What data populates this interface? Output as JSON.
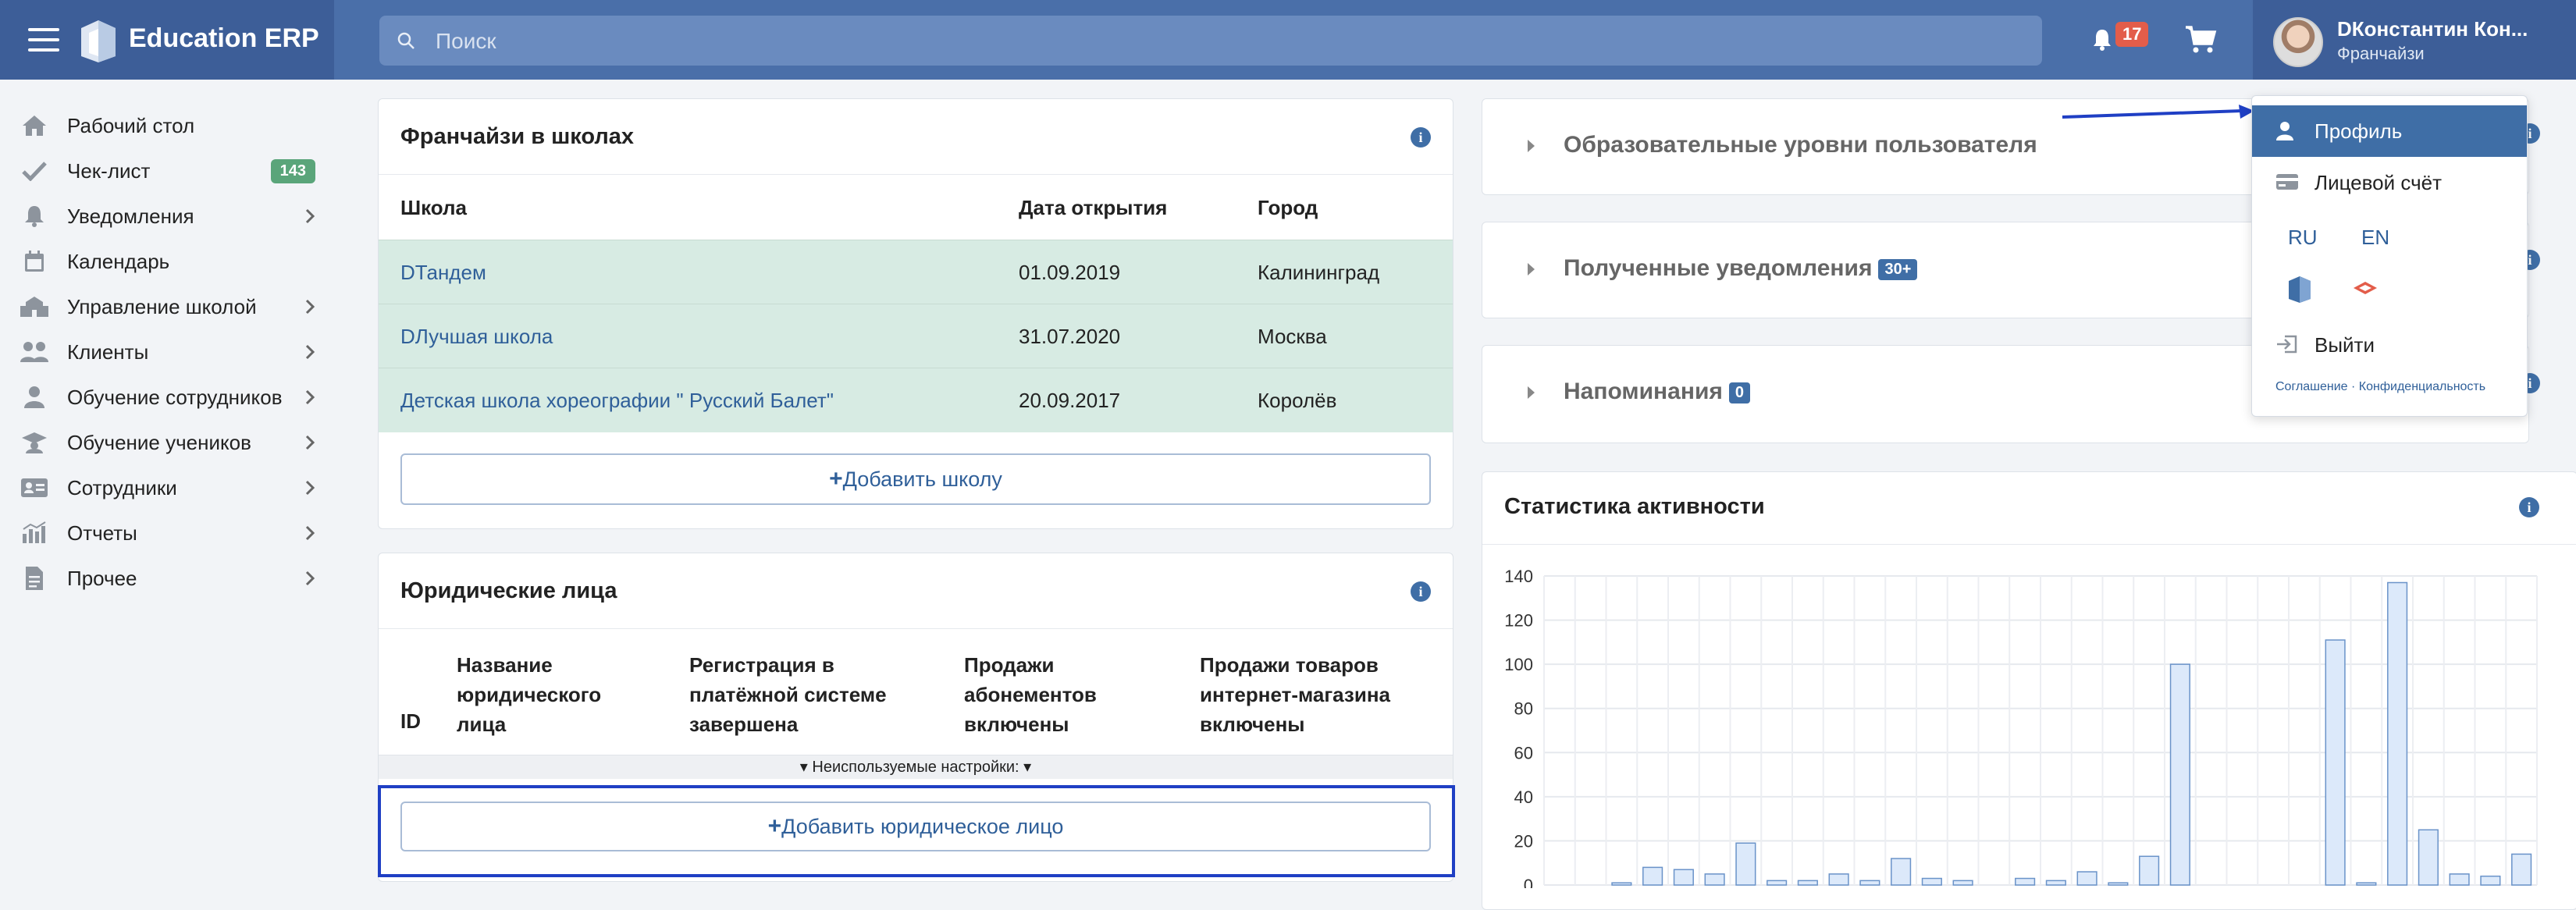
{
  "header": {
    "brand": "Education ERP",
    "search_placeholder": "Поиск",
    "notifications_count": "17",
    "user_name": "DКонстантин Кон...",
    "user_role": "Франчайзи"
  },
  "sidebar": {
    "items": [
      {
        "label": "Рабочий стол",
        "icon": "home-icon"
      },
      {
        "label": "Чек-лист",
        "icon": "check-icon",
        "badge": "143"
      },
      {
        "label": "Уведомления",
        "icon": "bell-icon"
      },
      {
        "label": "Календарь",
        "icon": "calendar-icon"
      },
      {
        "label": "Управление школой",
        "icon": "school-icon"
      },
      {
        "label": "Клиенты",
        "icon": "clients-icon"
      },
      {
        "label": "Обучение сотрудников",
        "icon": "staff-training-icon"
      },
      {
        "label": "Обучение учеников",
        "icon": "graduation-cap-icon"
      },
      {
        "label": "Сотрудники",
        "icon": "id-card-icon"
      },
      {
        "label": "Отчеты",
        "icon": "reports-icon"
      },
      {
        "label": "Прочее",
        "icon": "document-icon"
      }
    ]
  },
  "franchises": {
    "title": "Франчайзи в школах",
    "headers": {
      "school": "Школа",
      "date": "Дата открытия",
      "city": "Город"
    },
    "rows": [
      {
        "school": "DТандем",
        "date": "01.09.2019",
        "city": "Калининград"
      },
      {
        "school": "DЛучшая школа",
        "date": "31.07.2020",
        "city": "Москва"
      },
      {
        "school": "Детская школа хореографии \" Русский Балет\"",
        "date": "20.09.2017",
        "city": "Королёв"
      }
    ],
    "add_button": "Добавить школу"
  },
  "legal": {
    "title": "Юридические лица",
    "headers": {
      "id": "ID",
      "name": "Название юридического лица",
      "registration": "Регистрация в платёжной системе завершена",
      "subscriptions": "Продажи абонементов включены",
      "shop": "Продажи товаров интернет-магазина включены"
    },
    "unused_settings": "Неиспользуемые настройки:",
    "add_button": "Добавить юридическое лицо"
  },
  "accordions": [
    {
      "title": "Образовательные уровни пользователя",
      "tag": ""
    },
    {
      "title": "Полученные уведомления",
      "tag": "30+"
    },
    {
      "title": "Напоминания",
      "tag": "0"
    }
  ],
  "dropdown": {
    "profile": "Профиль",
    "account": "Лицевой счёт",
    "lang_ru": "RU",
    "lang_en": "EN",
    "logout": "Выйти",
    "footer": "Соглашение · Конфиденциальность"
  },
  "stats": {
    "title": "Статистика активности"
  },
  "chart_data": {
    "type": "bar",
    "title": "Статистика активности",
    "ylim": [
      0,
      140
    ],
    "yticks": [
      0,
      20,
      40,
      60,
      80,
      100,
      120,
      140
    ],
    "values": [
      0,
      0,
      1,
      8,
      7,
      5,
      19,
      2,
      2,
      5,
      2,
      12,
      3,
      2,
      0,
      3,
      2,
      6,
      1,
      13,
      100,
      0,
      0,
      0,
      0,
      111,
      1,
      137,
      25,
      5,
      4,
      14
    ],
    "grid": true,
    "bar_color": "#dce9fa",
    "bar_stroke": "#6a93c9"
  }
}
